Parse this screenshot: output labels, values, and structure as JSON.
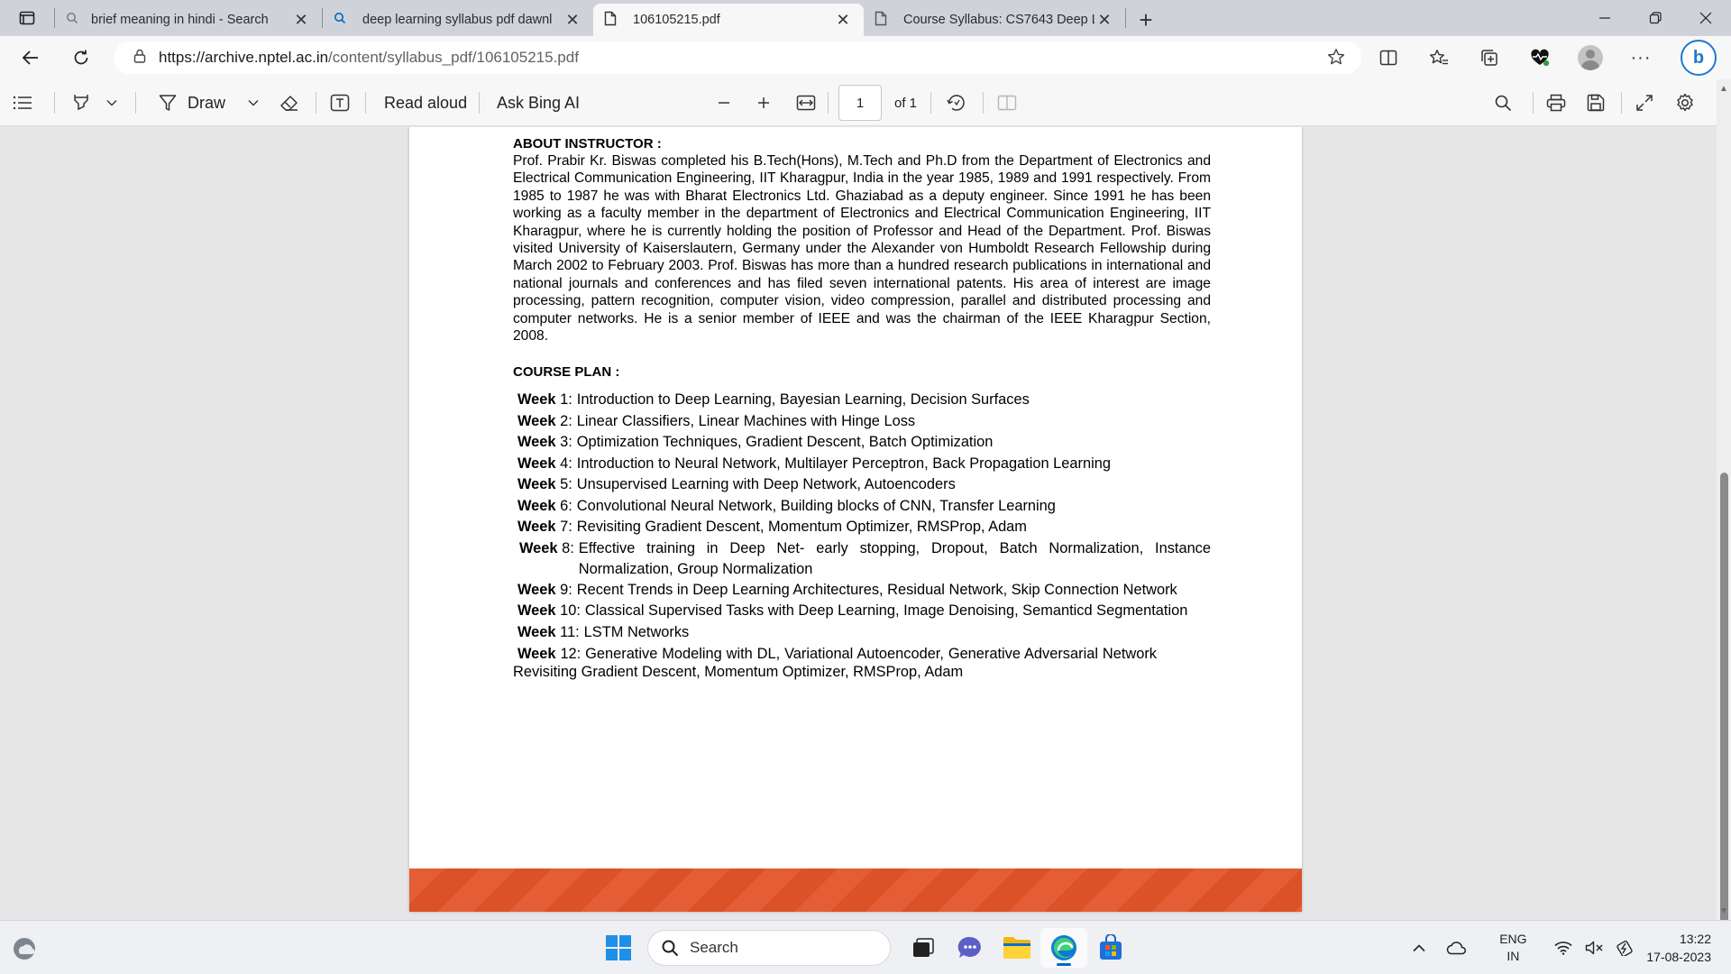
{
  "tabs": [
    {
      "title": "brief meaning in hindi - Search",
      "icon": "search-icon",
      "active": false
    },
    {
      "title": "deep learning syllabus pdf dawnl",
      "icon": "search-icon",
      "active": false
    },
    {
      "title": "106105215.pdf",
      "icon": "document-icon",
      "active": true
    },
    {
      "title": "Course Syllabus: CS7643 Deep Le",
      "icon": "document-icon",
      "active": false
    }
  ],
  "address": {
    "url_domain": "https://archive.nptel.ac.in",
    "url_path": "/content/syllabus_pdf/106105215.pdf"
  },
  "pdf_toolbar": {
    "draw_label": "Draw",
    "read_aloud_label": "Read aloud",
    "ask_bing_label": "Ask Bing AI",
    "page_number": "1",
    "page_total": "of 1"
  },
  "document": {
    "about_heading": "ABOUT INSTRUCTOR :",
    "about_text": "Prof. Prabir Kr. Biswas completed his B.Tech(Hons), M.Tech and Ph.D from the Department of Electronics and Electrical Communication Engineering, IIT Kharagpur, India in the year 1985, 1989 and 1991 respectively. From 1985 to 1987 he was with Bharat Electronics Ltd. Ghaziabad as a deputy engineer. Since 1991 he has been working as a faculty member in the department of Electronics and Electrical Communication Engineering, IIT Kharagpur, where he is currently holding the position of Professor and Head of the Department. Prof. Biswas visited University of Kaiserslautern, Germany under the Alexander von Humboldt Research Fellowship during March 2002 to February 2003. Prof. Biswas has more than a hundred research publications in international and national journals and conferences and has filed seven international patents. His area of interest are image processing, pattern recognition, computer vision, video compression, parallel and distributed processing and computer networks. He is a senior member of IEEE and was the chairman of the IEEE Kharagpur Section, 2008.",
    "plan_heading": "COURSE PLAN :",
    "weeks": [
      {
        "label": "Week",
        "num": "1:",
        "text": "Introduction to Deep Learning, Bayesian Learning, Decision Surfaces"
      },
      {
        "label": "Week",
        "num": "2:",
        "text": "Linear Classifiers, Linear Machines with Hinge Loss"
      },
      {
        "label": "Week",
        "num": "3:",
        "text": "Optimization Techniques, Gradient Descent, Batch Optimization"
      },
      {
        "label": "Week",
        "num": "4:",
        "text": "Introduction to Neural Network, Multilayer Perceptron, Back Propagation Learning"
      },
      {
        "label": "Week",
        "num": "5:",
        "text": "Unsupervised Learning with Deep Network, Autoencoders"
      },
      {
        "label": "Week",
        "num": "6:",
        "text": "Convolutional Neural Network, Building blocks of CNN, Transfer Learning"
      },
      {
        "label": "Week",
        "num": "7:",
        "text": "Revisiting Gradient Descent, Momentum Optimizer, RMSProp, Adam"
      },
      {
        "label": "Week",
        "num": "8:",
        "text": "Effective training in Deep Net- early stopping, Dropout, Batch Normalization, Instance Normalization, Group Normalization"
      },
      {
        "label": "Week",
        "num": "9:",
        "text": "Recent Trends in Deep Learning Architectures, Residual Network, Skip Connection Network"
      },
      {
        "label": "Week",
        "num": "10:",
        "text": "Classical Supervised Tasks with Deep Learning, Image Denoising, Semanticd Segmentation"
      },
      {
        "label": "Week",
        "num": "11:",
        "text": "LSTM Networks"
      },
      {
        "label": "Week",
        "num": "12:",
        "text": "Generative Modeling with DL, Variational Autoencoder, Generative Adversarial Network Revisiting Gradient Descent, Momentum Optimizer, RMSProp, Adam"
      }
    ]
  },
  "taskbar": {
    "search_label": "Search",
    "lang_line1": "ENG",
    "lang_line2": "IN",
    "time": "13:22",
    "date": "17-08-2023"
  },
  "colors": {
    "footer_band": "#e4542a",
    "accent": "#0067c0"
  }
}
